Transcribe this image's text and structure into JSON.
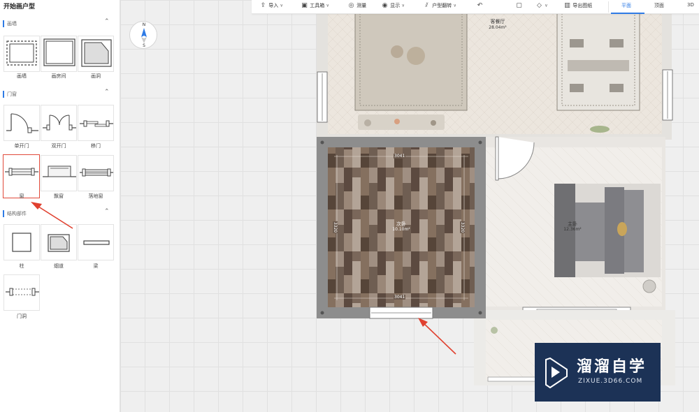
{
  "sidebar": {
    "title": "开始画户型",
    "sections": [
      {
        "label": "画墙",
        "chevron": "⌃",
        "items": [
          {
            "label": "画墙",
            "icon": "draw-wall-icon"
          },
          {
            "label": "画房间",
            "icon": "draw-room-icon"
          },
          {
            "label": "画洞",
            "icon": "draw-opening-icon"
          }
        ]
      },
      {
        "label": "门窗",
        "chevron": "⌃",
        "items": [
          {
            "label": "单开门",
            "icon": "single-door-icon"
          },
          {
            "label": "双开门",
            "icon": "double-door-icon"
          },
          {
            "label": "移门",
            "icon": "sliding-door-icon"
          },
          {
            "label": "窗",
            "icon": "window-icon"
          },
          {
            "label": "飘窗",
            "icon": "bay-window-icon"
          },
          {
            "label": "落地窗",
            "icon": "floor-window-icon"
          }
        ]
      },
      {
        "label": "结构部件",
        "chevron": "⌃",
        "items": [
          {
            "label": "柱",
            "icon": "column-icon"
          },
          {
            "label": "烟道",
            "icon": "flue-icon"
          },
          {
            "label": "梁",
            "icon": "beam-icon"
          },
          {
            "label": "门洞",
            "icon": "door-opening-icon"
          }
        ]
      }
    ],
    "collapse_glyph": "◂|"
  },
  "toolbar": {
    "items": [
      {
        "label": "导入",
        "icon": "import-icon",
        "glyph": "⇪",
        "dropdown": "∨"
      },
      {
        "label": "工具箱",
        "icon": "toolbox-icon",
        "glyph": "▣",
        "dropdown": "∨"
      },
      {
        "label": "测量",
        "icon": "measure-icon",
        "glyph": "◎",
        "dropdown": ""
      },
      {
        "label": "显示",
        "icon": "eye-icon",
        "glyph": "◉",
        "dropdown": "∨"
      },
      {
        "label": "户型翻转",
        "icon": "flip-icon",
        "glyph": "⫽",
        "dropdown": "∨"
      },
      {
        "label": "",
        "icon": "undo-icon",
        "glyph": "↶",
        "dropdown": ""
      },
      {
        "label": "",
        "icon": "save-icon",
        "glyph": "▢",
        "dropdown": ""
      },
      {
        "label": "",
        "icon": "eraser-icon",
        "glyph": "◇",
        "dropdown": "∨"
      },
      {
        "label": "导出图纸",
        "icon": "export-drawing-icon",
        "glyph": "▥",
        "dropdown": ""
      }
    ],
    "view_tabs": [
      {
        "label": "平面",
        "active": true
      },
      {
        "label": "顶面",
        "active": false
      },
      {
        "label": "3D",
        "active": false
      }
    ]
  },
  "compass": {
    "north": "N",
    "south": "S"
  },
  "plan": {
    "rooms": [
      {
        "name": "客餐厅",
        "area": "28.04m²"
      },
      {
        "name": "次卧",
        "area": "10.10m²"
      },
      {
        "name": "主卧",
        "area": "12.36m²"
      }
    ],
    "dimensions": {
      "top": "3041",
      "bottom": "3041",
      "left": "3320",
      "right": "3320"
    }
  },
  "watermark": {
    "title": "溜溜自学",
    "subtitle": "ZIXUE.3D66.COM"
  },
  "colors": {
    "accent": "#2f7be5",
    "highlight": "#e04a3a",
    "wall": "#8a8a8a",
    "wood": "#7d6a5b"
  }
}
